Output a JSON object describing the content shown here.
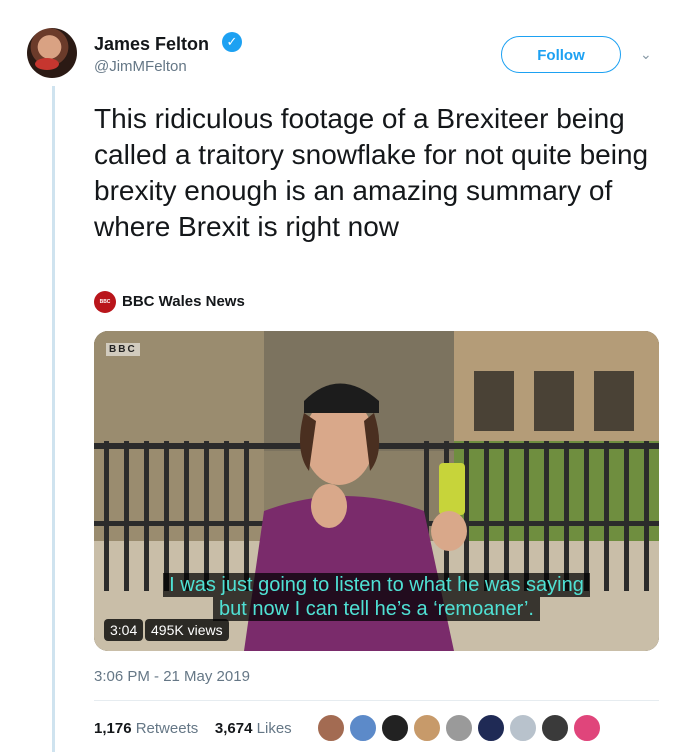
{
  "author": {
    "name": "James Felton",
    "handle": "@JimMFelton",
    "verified_icon": "verified-badge-icon"
  },
  "follow_label": "Follow",
  "tweet_text": "This ridiculous footage of a Brexiteer being called a traitory snowflake for not quite being brexity enough is an amazing summary of where Brexit is right now",
  "source": {
    "name": "BBC Wales News",
    "logo_text": "BBC WALES NEWS"
  },
  "video": {
    "watermark": "BBC",
    "subtitle_line1": "I was just going to listen to what he was saying",
    "subtitle_line2": "but now I can tell he’s a ‘remoaner’.",
    "duration": "3:04",
    "views": "495K views"
  },
  "timestamp": "3:06 PM - 21 May 2019",
  "stats": {
    "retweets_count": "1,176",
    "retweets_label": "Retweets",
    "likes_count": "3,674",
    "likes_label": "Likes"
  },
  "colors": {
    "accent": "#1da1f2",
    "subtitle": "#4fe1d4",
    "muted": "#657786"
  }
}
